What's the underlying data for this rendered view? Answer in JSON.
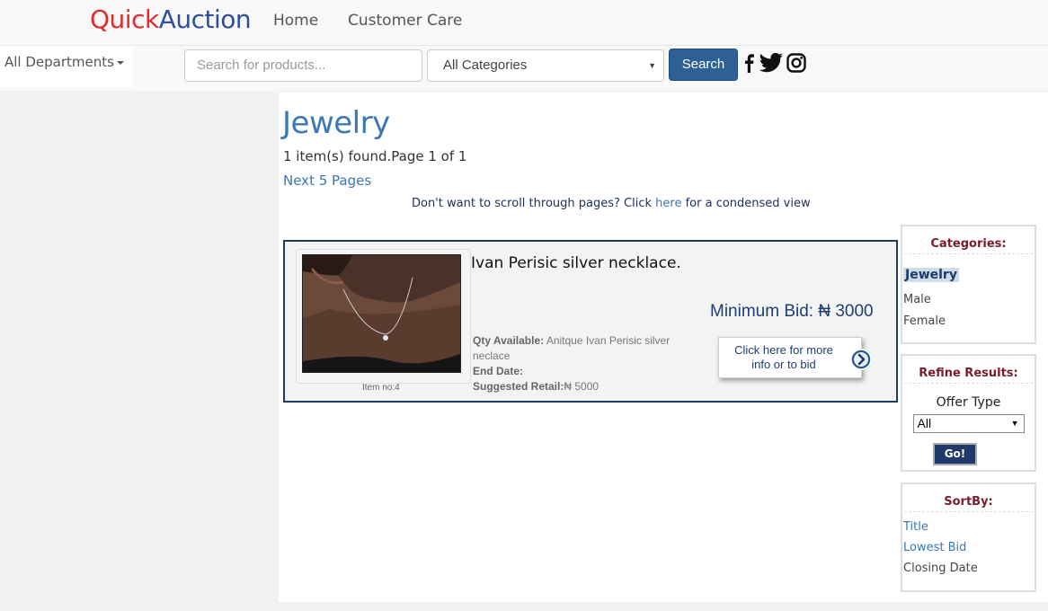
{
  "header": {
    "brand_part1": "Quick",
    "brand_part2": "Auction",
    "nav": [
      "Home",
      "Customer Care"
    ]
  },
  "search_bar": {
    "departments_label": "All Departments",
    "search_placeholder": "Search for products...",
    "category_selected": "All Categories",
    "search_button": "Search",
    "social_icons": [
      "facebook-icon",
      "twitter-icon",
      "instagram-icon"
    ]
  },
  "main": {
    "title": "Jewelry",
    "count_text": "1 item(s) found.Page 1 of 1",
    "next_pages_link": "Next 5 Pages",
    "condensed_pre": "Don't want to scroll through pages? Click",
    "condensed_link": "here",
    "condensed_post": "for a condensed view"
  },
  "item": {
    "item_no": "Item no:4",
    "title": "Ivan Perisic silver necklace.",
    "min_bid": "Minimum Bid: ₦ 3000",
    "qty_label": "Qty Available:",
    "qty_value": "Anitque Ivan Perisic silver neclace",
    "end_date_label": "End Date:",
    "end_date_value": "",
    "retail_label": "Suggested Retail:",
    "retail_value": "₦ 5000",
    "bid_button": "Click here for more info or to bid"
  },
  "sidebar": {
    "categories_title": "Categories:",
    "categories": [
      "Jewelry",
      "Male",
      "Female"
    ],
    "refine_title": "Refine Results:",
    "offer_type_label": "Offer Type",
    "offer_type_selected": "All",
    "go_button": "Go!",
    "sortby_title": "SortBy:",
    "sort_options": [
      "Title",
      "Lowest Bid",
      "Closing Date"
    ]
  },
  "colors": {
    "brand_red": "#e22b2b",
    "brand_blue": "#2f4d9c",
    "link_blue": "#3b78b5",
    "button_blue": "#2d6196",
    "panel_heading": "#7a1b2c"
  }
}
